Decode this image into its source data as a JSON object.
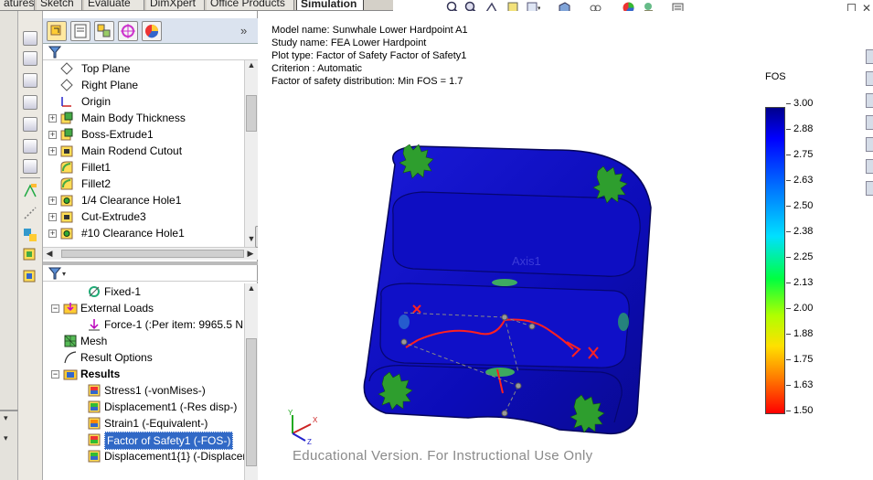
{
  "command_tabs": [
    {
      "label": "atures",
      "active": false
    },
    {
      "label": "Sketch",
      "active": false
    },
    {
      "label": "Evaluate",
      "active": false
    },
    {
      "label": "DimXpert",
      "active": false
    },
    {
      "label": "Office Products",
      "active": false
    },
    {
      "label": "Simulation",
      "active": true
    }
  ],
  "feature_tree": {
    "items": [
      {
        "label": "Top Plane",
        "icon": "plane-icon",
        "expandable": false
      },
      {
        "label": "Right Plane",
        "icon": "plane-icon",
        "expandable": false
      },
      {
        "label": "Origin",
        "icon": "origin-icon",
        "expandable": false
      },
      {
        "label": "Main Body Thickness",
        "icon": "extrude-icon",
        "expandable": true
      },
      {
        "label": "Boss-Extrude1",
        "icon": "extrude-icon",
        "expandable": true
      },
      {
        "label": "Main Rodend Cutout",
        "icon": "cut-icon",
        "expandable": true
      },
      {
        "label": "Fillet1",
        "icon": "fillet-icon",
        "expandable": false
      },
      {
        "label": "Fillet2",
        "icon": "fillet-icon",
        "expandable": false
      },
      {
        "label": "1/4 Clearance Hole1",
        "icon": "hole-icon",
        "expandable": true
      },
      {
        "label": "Cut-Extrude3",
        "icon": "cut-icon",
        "expandable": true
      },
      {
        "label": "#10 Clearance Hole1",
        "icon": "hole-icon",
        "expandable": true
      }
    ]
  },
  "simulation_tree": {
    "items": [
      {
        "label": "Fixed-1",
        "icon": "fixture-icon",
        "indent": 2,
        "expandable": false,
        "bold": false,
        "selected": false
      },
      {
        "label": "External Loads",
        "icon": "load-folder-icon",
        "indent": 1,
        "expandable": true,
        "bold": false,
        "selected": false
      },
      {
        "label": "Force-1 (:Per item: 9965.5 N:)",
        "icon": "force-arrow-icon",
        "indent": 2,
        "expandable": false,
        "bold": false,
        "selected": false
      },
      {
        "label": "Mesh",
        "icon": "mesh-icon",
        "indent": 1,
        "expandable": false,
        "bold": false,
        "selected": false
      },
      {
        "label": "Result Options",
        "icon": "result-options-icon",
        "indent": 1,
        "expandable": false,
        "bold": false,
        "selected": false
      },
      {
        "label": "Results",
        "icon": "results-folder-icon",
        "indent": 1,
        "expandable": true,
        "bold": true,
        "selected": false
      },
      {
        "label": "Stress1 (-vonMises-)",
        "icon": "stress-plot-icon",
        "indent": 2,
        "expandable": false,
        "bold": false,
        "selected": false
      },
      {
        "label": "Displacement1 (-Res disp-)",
        "icon": "displacement-plot-icon",
        "indent": 2,
        "expandable": false,
        "bold": false,
        "selected": false
      },
      {
        "label": "Strain1 (-Equivalent-)",
        "icon": "strain-plot-icon",
        "indent": 2,
        "expandable": false,
        "bold": false,
        "selected": false
      },
      {
        "label": "Factor of Safety1 (-FOS-)",
        "icon": "fos-plot-icon",
        "indent": 2,
        "expandable": false,
        "bold": false,
        "selected": true
      },
      {
        "label": "Displacement1{1} (-Displacem",
        "icon": "displacement-plot-icon",
        "indent": 2,
        "expandable": false,
        "bold": false,
        "selected": false
      }
    ]
  },
  "plot_info": {
    "model_name": "Model name: Sunwhale Lower Hardpoint A1",
    "study_name": "Study name: FEA Lower Hardpoint",
    "plot_type": "Plot type: Factor of Safety Factor of Safety1",
    "criterion": "Criterion : Automatic",
    "distribution": "Factor of safety distribution: Min FOS = 1.7"
  },
  "legend": {
    "title": "FOS",
    "ticks": [
      "3.00",
      "2.88",
      "2.75",
      "2.63",
      "2.50",
      "2.38",
      "2.25",
      "2.13",
      "2.00",
      "1.88",
      "1.75",
      "1.63",
      "1.50"
    ],
    "colors": {
      "high": "#00008c",
      "mid": "#00ff40",
      "low": "#ff0000"
    }
  },
  "model": {
    "axis_label": "Axis1",
    "body_color": "#1010c8",
    "fixture_color": "#2e9e2e",
    "load_color": "#ff2020",
    "triad_labels": {
      "x": "X",
      "y": "Y",
      "z": "Z"
    }
  },
  "watermark": "Educational Version. For Instructional Use Only"
}
